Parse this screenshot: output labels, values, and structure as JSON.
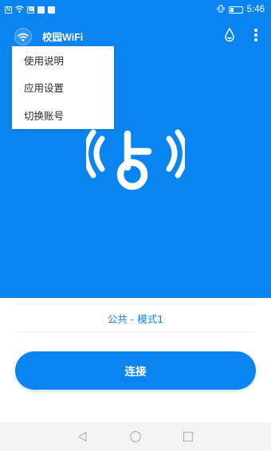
{
  "status_bar": {
    "left_icons": [
      "N",
      "☎",
      "▮",
      "▣",
      "▣"
    ],
    "battery_percent": 30,
    "time": "5:46"
  },
  "app_bar": {
    "title": "校园WiFi",
    "icons": [
      "wifi-logo-icon",
      "water-drop-icon",
      "more-vertical-icon"
    ]
  },
  "menu": {
    "items": [
      {
        "label": "使用说明"
      },
      {
        "label": "应用设置"
      },
      {
        "label": "切换账号"
      }
    ]
  },
  "mode": {
    "label": "公共 - 模式1"
  },
  "connect": {
    "label": "连接"
  },
  "nav": {
    "icons": [
      "back-triangle-icon",
      "home-circle-icon",
      "recents-square-icon"
    ]
  },
  "colors": {
    "accent": "#0a84ee",
    "menu_text": "#2a2a2a",
    "nav_bg": "#f4f4f4"
  }
}
